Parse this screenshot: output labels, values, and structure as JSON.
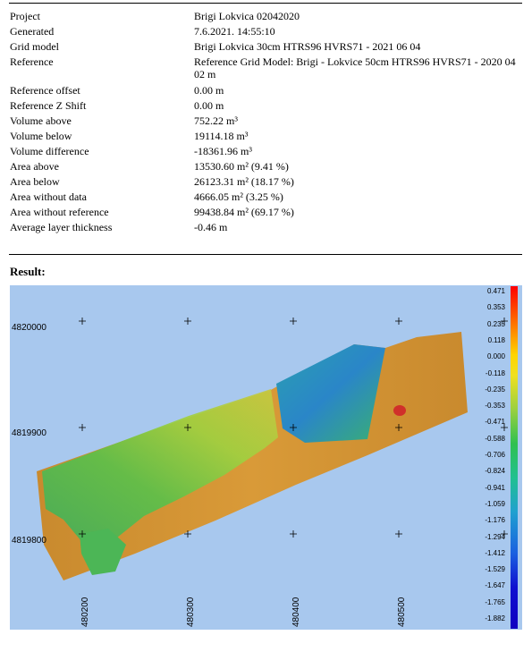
{
  "report": {
    "rows": [
      {
        "label": "Project",
        "value": "Brigi Lokvica 02042020"
      },
      {
        "label": "Generated",
        "value": "7.6.2021. 14:55:10"
      },
      {
        "label": "Grid model",
        "value": "Brigi Lokvica 30cm HTRS96 HVRS71 - 2021 06 04"
      },
      {
        "label": "Reference",
        "value": "Reference Grid Model: Brigi - Lokvice 50cm HTRS96 HVRS71 - 2020 04 02 m"
      },
      {
        "label": "Reference offset",
        "value": "0.00 m"
      },
      {
        "label": "Reference Z Shift",
        "value": "0.00 m"
      },
      {
        "label": "Volume above",
        "value": "752.22 m³"
      },
      {
        "label": "Volume below",
        "value": "19114.18 m³"
      },
      {
        "label": "Volume difference",
        "value": "-18361.96 m³"
      },
      {
        "label": "Area above",
        "value": "13530.60 m² (9.41 %)"
      },
      {
        "label": "Area below",
        "value": "26123.31 m² (18.17 %)"
      },
      {
        "label": "Area without data",
        "value": "4666.05 m² (3.25 %)"
      },
      {
        "label": "Area without reference",
        "value": "99438.84 m² (69.17 %)"
      },
      {
        "label": "Average layer thickness",
        "value": "-0.46 m"
      }
    ]
  },
  "result": {
    "title": "Result:",
    "y_ticks": [
      "4820000",
      "4819900",
      "4819800"
    ],
    "x_ticks": [
      "480200",
      "480300",
      "480400",
      "480500"
    ],
    "legend": [
      "0.471",
      "0.353",
      "0.235",
      "0.118",
      "0.000",
      "-0.118",
      "-0.235",
      "-0.353",
      "-0.471",
      "-0.588",
      "-0.706",
      "-0.824",
      "-0.941",
      "-1.059",
      "-1.176",
      "-1.294",
      "-1.412",
      "-1.529",
      "-1.647",
      "-1.765",
      "-1.882"
    ],
    "colors": {
      "background": "#a8c8ee",
      "cut": "#d98e2c",
      "fill": "#2ab56a",
      "deep": "#2070d0"
    }
  }
}
